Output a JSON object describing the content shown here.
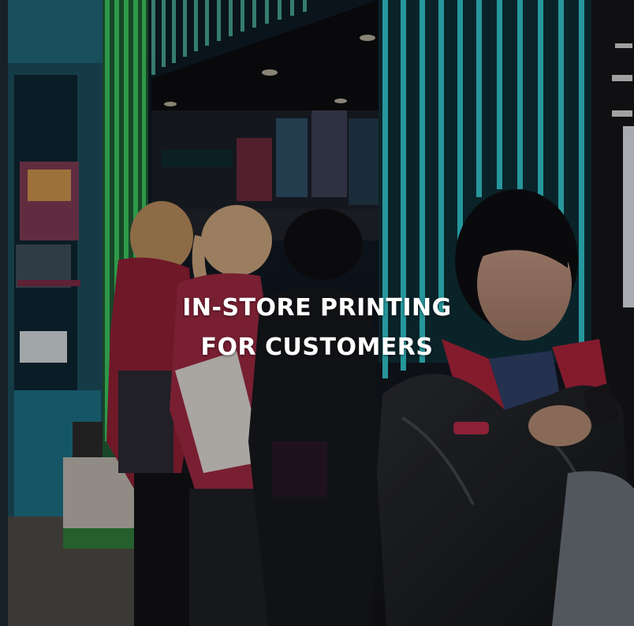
{
  "headline": {
    "line1": "IN-STORE PRINTING",
    "line2": "FOR CUSTOMERS"
  },
  "colors": {
    "neon_cyan": "#35d3d8",
    "neon_green": "#3fcf63",
    "jacket_red": "#a8233a",
    "text": "#ffffff"
  }
}
